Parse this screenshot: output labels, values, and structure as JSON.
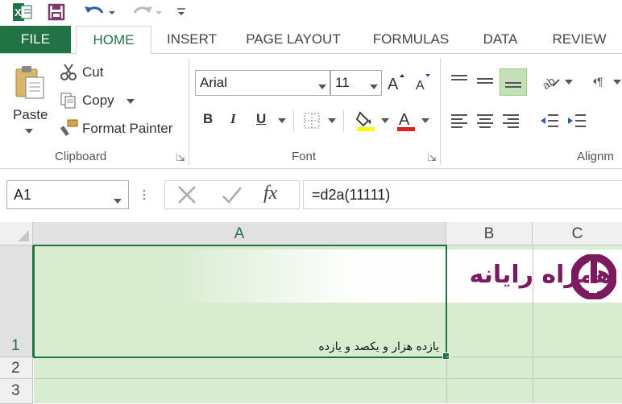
{
  "qat": {
    "save_icon": "save-icon",
    "undo_icon": "undo-icon",
    "redo_icon": "redo-icon"
  },
  "tabs": [
    "FILE",
    "HOME",
    "INSERT",
    "PAGE LAYOUT",
    "FORMULAS",
    "DATA",
    "REVIEW"
  ],
  "clipboard": {
    "paste": "Paste",
    "cut": "Cut",
    "copy": "Copy",
    "format_painter": "Format Painter",
    "group": "Clipboard"
  },
  "font": {
    "name": "Arial",
    "size": "11",
    "group": "Font",
    "bold": "B",
    "italic": "I",
    "underline": "U"
  },
  "alignment": {
    "group": "Alignm"
  },
  "formula_bar": {
    "name_box": "A1",
    "fx": "fx",
    "formula": "=d2a(11111)"
  },
  "columns": [
    "A",
    "B",
    "C"
  ],
  "rows": [
    "1",
    "2",
    "3"
  ],
  "cell_a1": "یازده هزار و یکصد و یازده",
  "watermark": {
    "text": "همراه رایانه"
  },
  "colors": {
    "excel_green": "#217346",
    "selection": "#d8ecd0",
    "watermark_purple": "#7b1a5e"
  }
}
